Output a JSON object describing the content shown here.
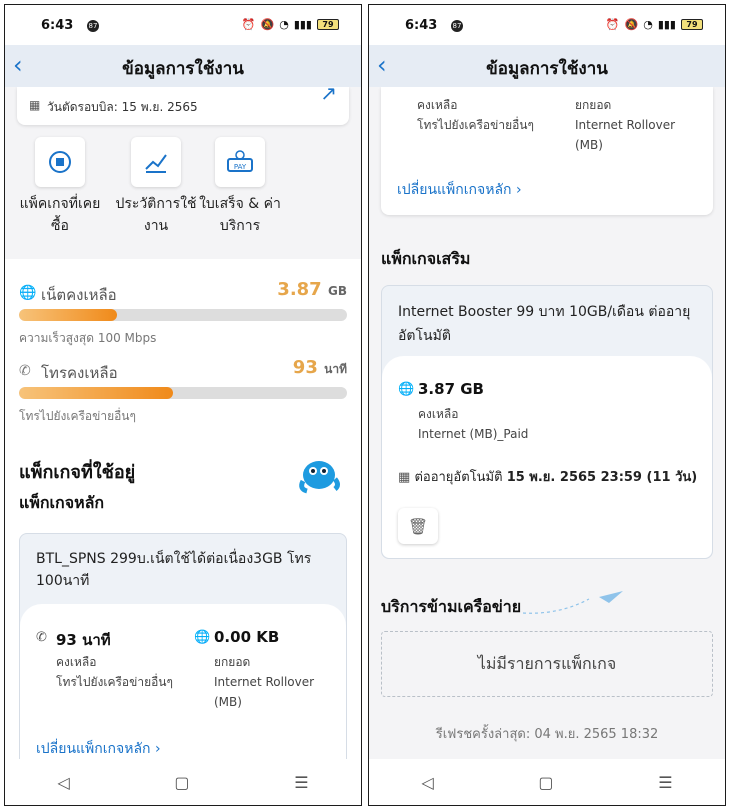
{
  "status_bar": {
    "time": "6:43",
    "notification_count": "87",
    "battery": "79"
  },
  "app_bar": {
    "title": "ข้อมูลการใช้งาน"
  },
  "bill_cycle": {
    "text": "วันตัดรอบบิล: 15 พ.ย. 2565"
  },
  "shortcuts": [
    {
      "label": "แพ็คเกจที่เคยซื้อ",
      "icon": "package-icon"
    },
    {
      "label": "ประวัติการใช้งาน",
      "icon": "chart-icon"
    },
    {
      "label": "ใบเสร็จ & ค่าบริการ",
      "icon": "pay-icon"
    }
  ],
  "usage": {
    "net": {
      "label": "เน็ตคงเหลือ",
      "amount": "3.87",
      "unit": "GB",
      "note": "ความเร็วสูงสุด 100 Mbps",
      "progress": 0.3
    },
    "call": {
      "label": "โทรคงเหลือ",
      "amount": "93",
      "unit": "นาที",
      "note": "โทรไปยังเครือข่ายอื่นๆ",
      "progress": 0.47
    }
  },
  "packages": {
    "section_title": "แพ็กเกจที่ใช้อยู่",
    "main_title": "แพ็กเกจหลัก",
    "main": {
      "name": "BTL_SPNS 299บ.เน็ตใช้ได้ต่อเนื่อง3GB โทร 100นาที",
      "call_value": "93 นาที",
      "call_sub1": "คงเหลือ",
      "call_sub2": "โทรไปยังเครือข่ายอื่นๆ",
      "data_value": "0.00 KB",
      "data_sub1": "ยกยอด",
      "data_sub2": "Internet Rollover",
      "data_sub3": "(MB)",
      "change_link": "เปลี่ยนแพ็กเกจหลัก"
    },
    "addon_title": "แพ็กเกจเสริม",
    "addon": {
      "name": "Internet Booster 99 บาท 10GB/เดือน ต่ออายุอัตโนมัติ",
      "data_value": "3.87 GB",
      "data_sub1": "คงเหลือ",
      "data_sub2": "Internet (MB)_Paid",
      "renew_label": "ต่ออายุอัตโนมัติ",
      "renew_value": "15 พ.ย. 2565 23:59 (11 วัน)"
    }
  },
  "roaming": {
    "title": "บริการข้ามเครือข่าย",
    "empty_text": "ไม่มีรายการแพ็กเกจ"
  },
  "refresh": {
    "text": "รีเฟรชครั้งล่าสุด: 04 พ.ย. 2565 18:32"
  }
}
